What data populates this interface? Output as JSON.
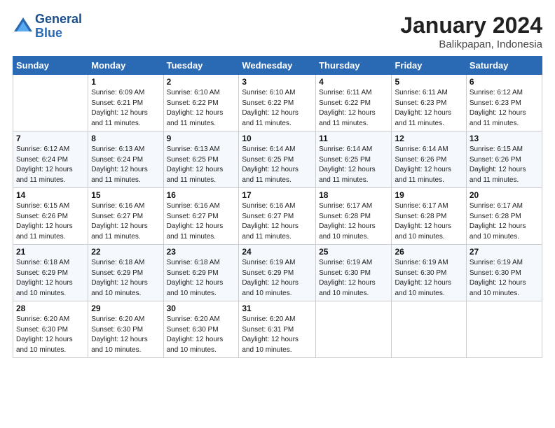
{
  "header": {
    "logo_line1": "General",
    "logo_line2": "Blue",
    "main_title": "January 2024",
    "subtitle": "Balikpapan, Indonesia"
  },
  "calendar": {
    "days_of_week": [
      "Sunday",
      "Monday",
      "Tuesday",
      "Wednesday",
      "Thursday",
      "Friday",
      "Saturday"
    ],
    "weeks": [
      [
        {
          "day": "",
          "info": ""
        },
        {
          "day": "1",
          "info": "Sunrise: 6:09 AM\nSunset: 6:21 PM\nDaylight: 12 hours\nand 11 minutes."
        },
        {
          "day": "2",
          "info": "Sunrise: 6:10 AM\nSunset: 6:22 PM\nDaylight: 12 hours\nand 11 minutes."
        },
        {
          "day": "3",
          "info": "Sunrise: 6:10 AM\nSunset: 6:22 PM\nDaylight: 12 hours\nand 11 minutes."
        },
        {
          "day": "4",
          "info": "Sunrise: 6:11 AM\nSunset: 6:22 PM\nDaylight: 12 hours\nand 11 minutes."
        },
        {
          "day": "5",
          "info": "Sunrise: 6:11 AM\nSunset: 6:23 PM\nDaylight: 12 hours\nand 11 minutes."
        },
        {
          "day": "6",
          "info": "Sunrise: 6:12 AM\nSunset: 6:23 PM\nDaylight: 12 hours\nand 11 minutes."
        }
      ],
      [
        {
          "day": "7",
          "info": "Sunrise: 6:12 AM\nSunset: 6:24 PM\nDaylight: 12 hours\nand 11 minutes."
        },
        {
          "day": "8",
          "info": "Sunrise: 6:13 AM\nSunset: 6:24 PM\nDaylight: 12 hours\nand 11 minutes."
        },
        {
          "day": "9",
          "info": "Sunrise: 6:13 AM\nSunset: 6:25 PM\nDaylight: 12 hours\nand 11 minutes."
        },
        {
          "day": "10",
          "info": "Sunrise: 6:14 AM\nSunset: 6:25 PM\nDaylight: 12 hours\nand 11 minutes."
        },
        {
          "day": "11",
          "info": "Sunrise: 6:14 AM\nSunset: 6:25 PM\nDaylight: 12 hours\nand 11 minutes."
        },
        {
          "day": "12",
          "info": "Sunrise: 6:14 AM\nSunset: 6:26 PM\nDaylight: 12 hours\nand 11 minutes."
        },
        {
          "day": "13",
          "info": "Sunrise: 6:15 AM\nSunset: 6:26 PM\nDaylight: 12 hours\nand 11 minutes."
        }
      ],
      [
        {
          "day": "14",
          "info": "Sunrise: 6:15 AM\nSunset: 6:26 PM\nDaylight: 12 hours\nand 11 minutes."
        },
        {
          "day": "15",
          "info": "Sunrise: 6:16 AM\nSunset: 6:27 PM\nDaylight: 12 hours\nand 11 minutes."
        },
        {
          "day": "16",
          "info": "Sunrise: 6:16 AM\nSunset: 6:27 PM\nDaylight: 12 hours\nand 11 minutes."
        },
        {
          "day": "17",
          "info": "Sunrise: 6:16 AM\nSunset: 6:27 PM\nDaylight: 12 hours\nand 11 minutes."
        },
        {
          "day": "18",
          "info": "Sunrise: 6:17 AM\nSunset: 6:28 PM\nDaylight: 12 hours\nand 10 minutes."
        },
        {
          "day": "19",
          "info": "Sunrise: 6:17 AM\nSunset: 6:28 PM\nDaylight: 12 hours\nand 10 minutes."
        },
        {
          "day": "20",
          "info": "Sunrise: 6:17 AM\nSunset: 6:28 PM\nDaylight: 12 hours\nand 10 minutes."
        }
      ],
      [
        {
          "day": "21",
          "info": "Sunrise: 6:18 AM\nSunset: 6:29 PM\nDaylight: 12 hours\nand 10 minutes."
        },
        {
          "day": "22",
          "info": "Sunrise: 6:18 AM\nSunset: 6:29 PM\nDaylight: 12 hours\nand 10 minutes."
        },
        {
          "day": "23",
          "info": "Sunrise: 6:18 AM\nSunset: 6:29 PM\nDaylight: 12 hours\nand 10 minutes."
        },
        {
          "day": "24",
          "info": "Sunrise: 6:19 AM\nSunset: 6:29 PM\nDaylight: 12 hours\nand 10 minutes."
        },
        {
          "day": "25",
          "info": "Sunrise: 6:19 AM\nSunset: 6:30 PM\nDaylight: 12 hours\nand 10 minutes."
        },
        {
          "day": "26",
          "info": "Sunrise: 6:19 AM\nSunset: 6:30 PM\nDaylight: 12 hours\nand 10 minutes."
        },
        {
          "day": "27",
          "info": "Sunrise: 6:19 AM\nSunset: 6:30 PM\nDaylight: 12 hours\nand 10 minutes."
        }
      ],
      [
        {
          "day": "28",
          "info": "Sunrise: 6:20 AM\nSunset: 6:30 PM\nDaylight: 12 hours\nand 10 minutes."
        },
        {
          "day": "29",
          "info": "Sunrise: 6:20 AM\nSunset: 6:30 PM\nDaylight: 12 hours\nand 10 minutes."
        },
        {
          "day": "30",
          "info": "Sunrise: 6:20 AM\nSunset: 6:30 PM\nDaylight: 12 hours\nand 10 minutes."
        },
        {
          "day": "31",
          "info": "Sunrise: 6:20 AM\nSunset: 6:31 PM\nDaylight: 12 hours\nand 10 minutes."
        },
        {
          "day": "",
          "info": ""
        },
        {
          "day": "",
          "info": ""
        },
        {
          "day": "",
          "info": ""
        }
      ]
    ]
  }
}
